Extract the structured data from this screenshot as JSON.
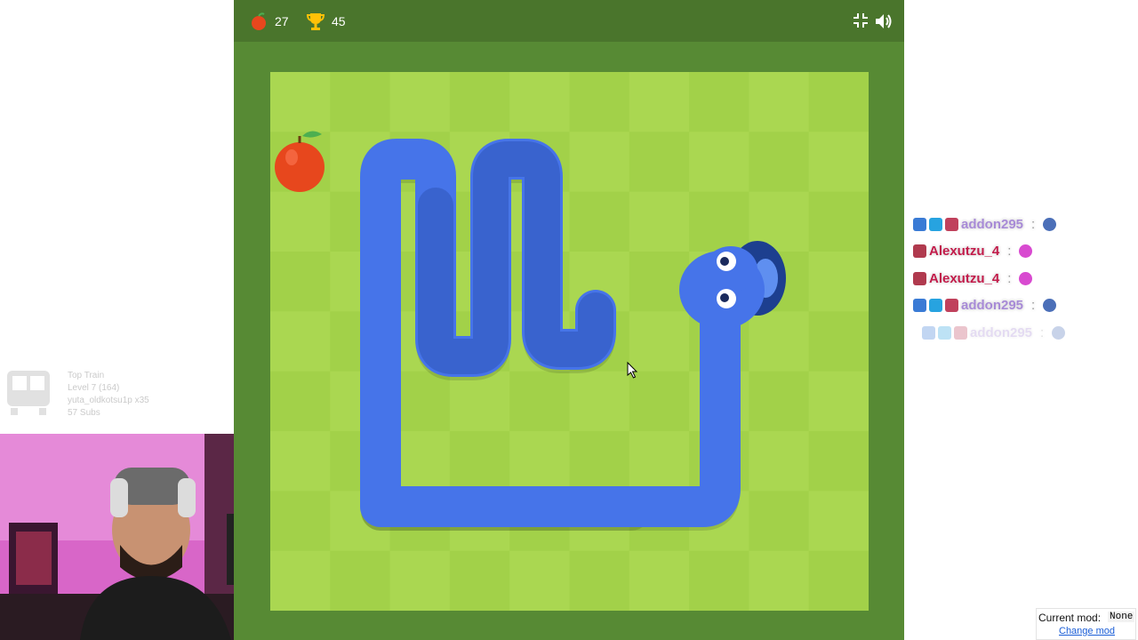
{
  "hud": {
    "score": "27",
    "high_score": "45",
    "apple_icon": "apple-icon",
    "trophy_icon": "trophy-icon",
    "fullscreen_icon": "fullscreen-icon",
    "sound_icon": "speaker-icon"
  },
  "colors": {
    "header": "#4a752c",
    "frame": "#578a34",
    "grass_light": "#aad751",
    "grass_dark": "#a2d149",
    "snake": "#4674e9",
    "apple": "#e7471d"
  },
  "board": {
    "columns": 10,
    "rows": 9
  },
  "train_widget": {
    "title": "Top Train",
    "level": "Level 7 (164)",
    "user": "yuta_oldkotsu1p x35",
    "subs": "57 Subs"
  },
  "chat": {
    "messages": [
      {
        "user": "addon295",
        "color": "#a78ad6",
        "faded": false
      },
      {
        "user": "Alexutzu_4",
        "color": "#c21b4a",
        "faded": false
      },
      {
        "user": "Alexutzu_4",
        "color": "#c21b4a",
        "faded": false
      },
      {
        "user": "addon295",
        "color": "#a78ad6",
        "faded": false
      },
      {
        "user": "addon295",
        "color": "#a78ad6",
        "faded": true
      }
    ]
  },
  "mod": {
    "label": "Current mod:",
    "value": "None",
    "link": "Change mod"
  }
}
